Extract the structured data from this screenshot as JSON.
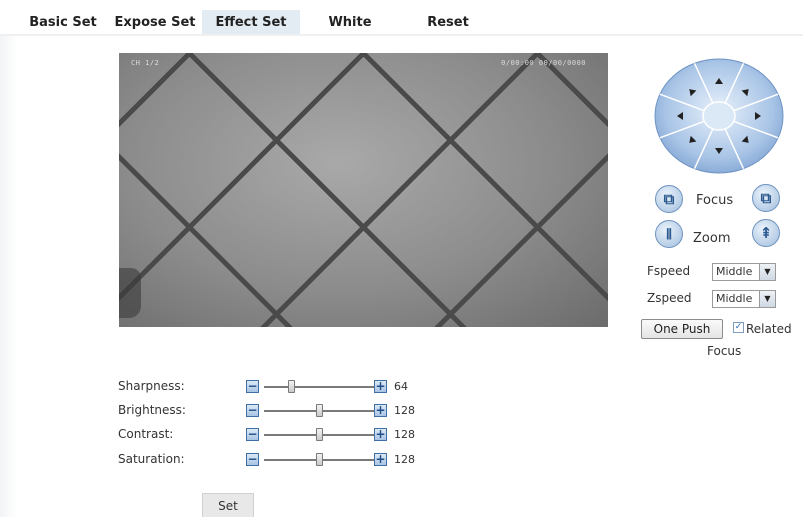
{
  "tabs": [
    {
      "label": "Basic Set",
      "active": false
    },
    {
      "label": "Expose Set",
      "active": false
    },
    {
      "label": "Effect Set",
      "active": true
    },
    {
      "label": "White",
      "active": false
    },
    {
      "label": "Reset",
      "active": false
    }
  ],
  "video": {
    "osd_left": "CH 1/2",
    "osd_right": "0/00:00 00/00/0000"
  },
  "ptz": {
    "directions": [
      "up",
      "up-right",
      "right",
      "down-right",
      "down",
      "down-left",
      "left",
      "up-left"
    ],
    "accent": "#6e9bd3"
  },
  "focus": {
    "label": "Focus"
  },
  "zoom": {
    "label": "Zoom"
  },
  "fspeed": {
    "label": "Fspeed",
    "value": "Middle"
  },
  "zspeed": {
    "label": "Zspeed",
    "value": "Middle"
  },
  "one_push": {
    "label": "One Push"
  },
  "related_focus": {
    "label_line1": "Related",
    "label_line2": "Focus",
    "checked": true
  },
  "sliders": [
    {
      "label": "Sharpness:",
      "value": "64",
      "fraction": 0.25
    },
    {
      "label": "Brightness:",
      "value": "128",
      "fraction": 0.5
    },
    {
      "label": "Contrast:",
      "value": "128",
      "fraction": 0.5
    },
    {
      "label": "Saturation:",
      "value": "128",
      "fraction": 0.5
    }
  ],
  "set_button": {
    "label": "Set"
  }
}
